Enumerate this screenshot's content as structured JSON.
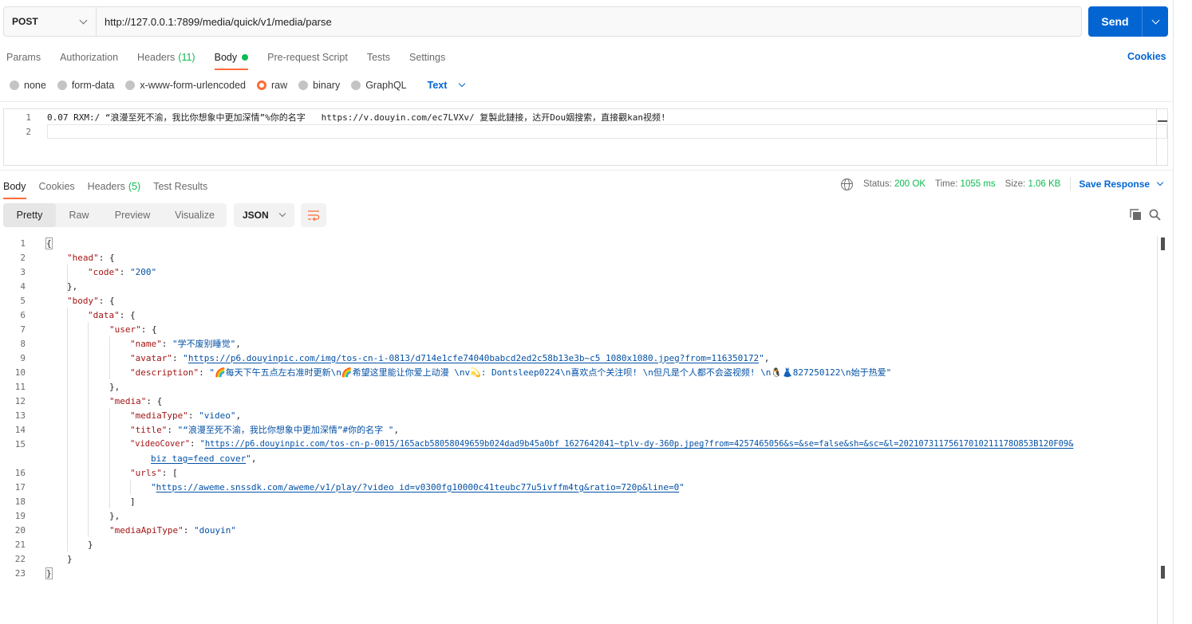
{
  "request": {
    "method": "POST",
    "url": "http://127.0.0.1:7899/media/quick/v1/media/parse",
    "send_label": "Send"
  },
  "req_tabs": {
    "params": "Params",
    "authorization": "Authorization",
    "headers": "Headers",
    "headers_count": "(11)",
    "body": "Body",
    "prerequest": "Pre-request Script",
    "tests": "Tests",
    "settings": "Settings",
    "cookies": "Cookies"
  },
  "body_types": {
    "none": "none",
    "form_data": "form-data",
    "urlencoded": "x-www-form-urlencoded",
    "raw": "raw",
    "binary": "binary",
    "graphql": "GraphQL",
    "format": "Text"
  },
  "req_body": {
    "lines": [
      {
        "n": "1",
        "text": "0.07 RXM:/ “浪漫至死不渝，我比你想象中更加深情”%你的名字   https://v.douyin.com/ec7LVXv/ 复製此鏈接，达开Dou姻搜索，直接觀kan视频!"
      },
      {
        "n": "2",
        "text": ""
      }
    ]
  },
  "resp_tabs": {
    "body": "Body",
    "cookies": "Cookies",
    "headers": "Headers",
    "headers_count": "(5)",
    "test_results": "Test Results"
  },
  "status": {
    "status_label": "Status:",
    "status_value": "200 OK",
    "time_label": "Time:",
    "time_value": "1055 ms",
    "size_label": "Size:",
    "size_value": "1.06 KB",
    "save_response": "Save Response"
  },
  "views": {
    "pretty": "Pretty",
    "raw": "Raw",
    "preview": "Preview",
    "visualize": "Visualize",
    "format": "JSON"
  },
  "response": {
    "line_numbers": [
      "1",
      "2",
      "3",
      "4",
      "5",
      "6",
      "7",
      "8",
      "9",
      "10",
      "11",
      "12",
      "13",
      "14",
      "15",
      "",
      "16",
      "17",
      "18",
      "19",
      "20",
      "21",
      "22",
      "23"
    ],
    "open_brace": "{",
    "close_brace": "}",
    "head_key": "\"head\"",
    "code_key": "\"code\"",
    "code_val": "\"200\"",
    "body_key": "\"body\"",
    "data_key": "\"data\"",
    "user_key": "\"user\"",
    "name_key": "\"name\"",
    "name_val": "\"学不废别睡觉\"",
    "avatar_key": "\"avatar\"",
    "avatar_val": "https://p6.douyinpic.com/img/tos-cn-i-0813/d714e1cfe74040babcd2ed2c58b13e3b~c5_1080x1080.jpeg?from=116350172",
    "description_key": "\"description\"",
    "description_val": "\"🌈每天下午五点左右准时更新\\n🌈希望这里能让你爱上动漫 \\nv💫: Dontsleep0224\\n喜欢点个关注呗! \\n但凡是个人都不会盗视频! \\n🐧👗827250122\\n始于热爱\"",
    "media_key": "\"media\"",
    "mediatype_key": "\"mediaType\"",
    "mediatype_val": "\"video\"",
    "title_key": "\"title\"",
    "title_val": "\"“浪漫至死不渝，我比你想象中更加深情”#你的名字 \"",
    "videocover_key": "\"videoCover\"",
    "videocover_val_1": "https://p6.douyinpic.com/tos-cn-p-0015/165acb58058049659b024dad9b45a0bf_1627642041~tplv-dy-360p.jpeg?from=4257465056&s=&se=false&sh=&sc=&l=20210731175617010211178O853B120F09&",
    "videocover_val_2": "biz_tag=feed_cover",
    "urls_key": "\"urls\"",
    "urls_val": "https://aweme.snssdk.com/aweme/v1/play/?video_id=v0300fg10000c41teubc77u5ivffm4tg&ratio=720p&line=0",
    "mediaapitype_key": "\"mediaApiType\"",
    "mediaapitype_val": "\"douyin\""
  },
  "colors": {
    "accent": "#ff6c37",
    "primary": "#0265d2",
    "success": "#0cbb52"
  }
}
